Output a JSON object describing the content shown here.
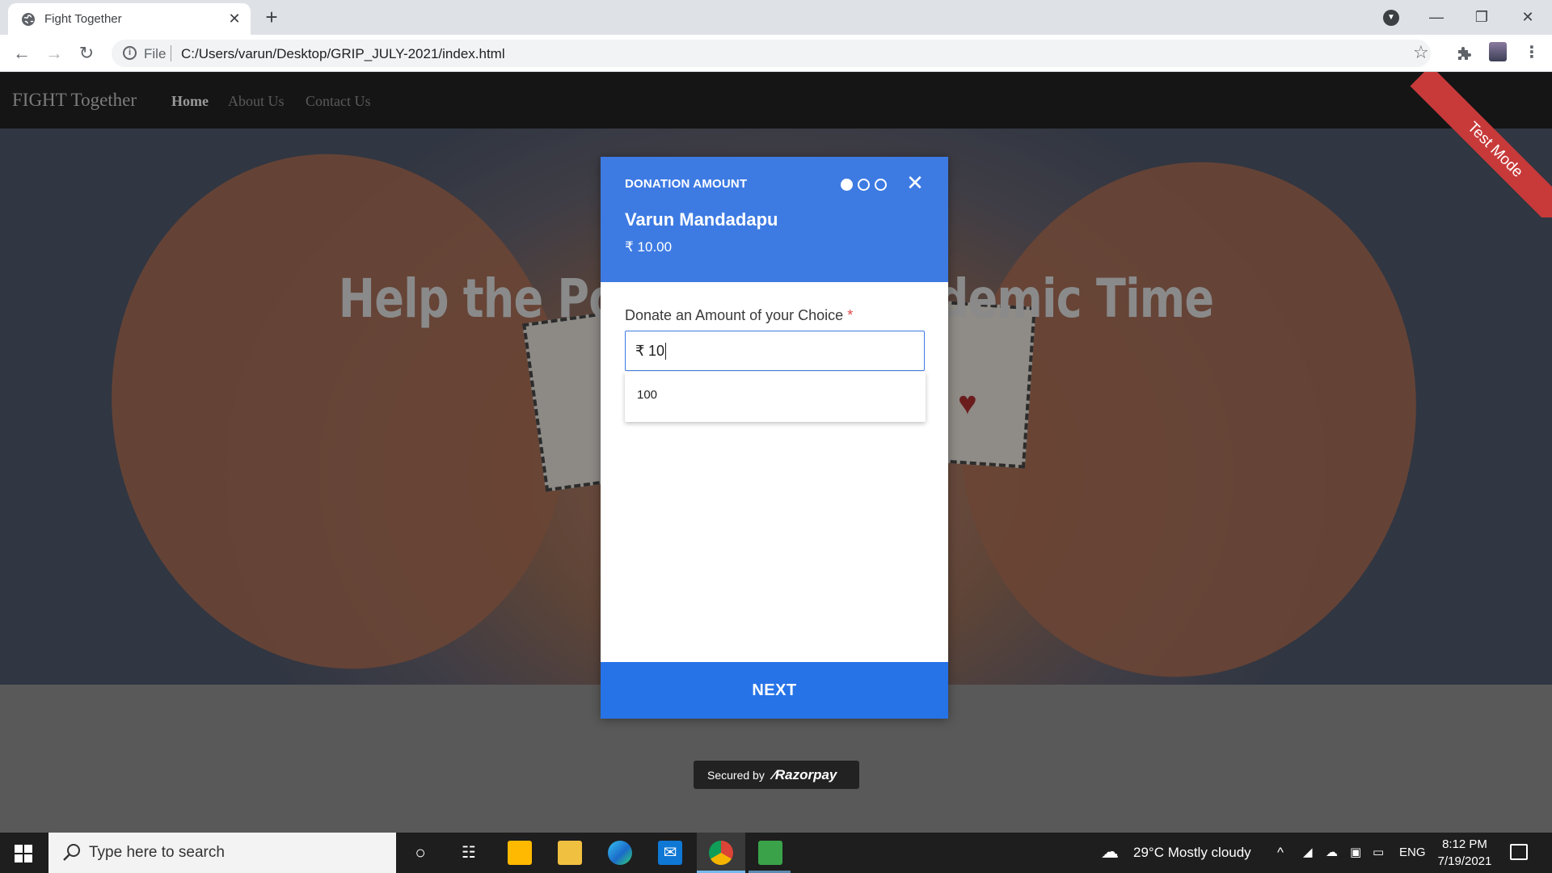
{
  "browser": {
    "tab_title": "Fight Together",
    "omnibox_scheme": "File",
    "url": "C:/Users/varun/Desktop/GRIP_JULY-2021/index.html"
  },
  "site": {
    "brand": "FIGHT Together",
    "nav": [
      {
        "label": "Home",
        "active": true
      },
      {
        "label": "About Us",
        "active": false
      },
      {
        "label": "Contact Us",
        "active": false
      }
    ],
    "hero_title": "Help the Poor in this pandemic Time",
    "test_mode": "Test Mode"
  },
  "modal": {
    "section_label": "DONATION AMOUNT",
    "step_current": 1,
    "step_total": 3,
    "merchant_name": "Varun Mandadapu",
    "amount": "₹ 10.00",
    "field_label": "Donate an Amount of your Choice",
    "required_mark": "*",
    "currency_symbol": "₹",
    "input_value": "10",
    "suggestions": [
      "100"
    ],
    "next_label": "NEXT",
    "accent_color": "#2673e8"
  },
  "secured": {
    "prefix": "Secured by",
    "brand": "Razorpay"
  },
  "taskbar": {
    "search_placeholder": "Type here to search",
    "weather": "29°C  Mostly cloudy",
    "language": "ENG",
    "time": "8:12 PM",
    "date": "7/19/2021"
  }
}
